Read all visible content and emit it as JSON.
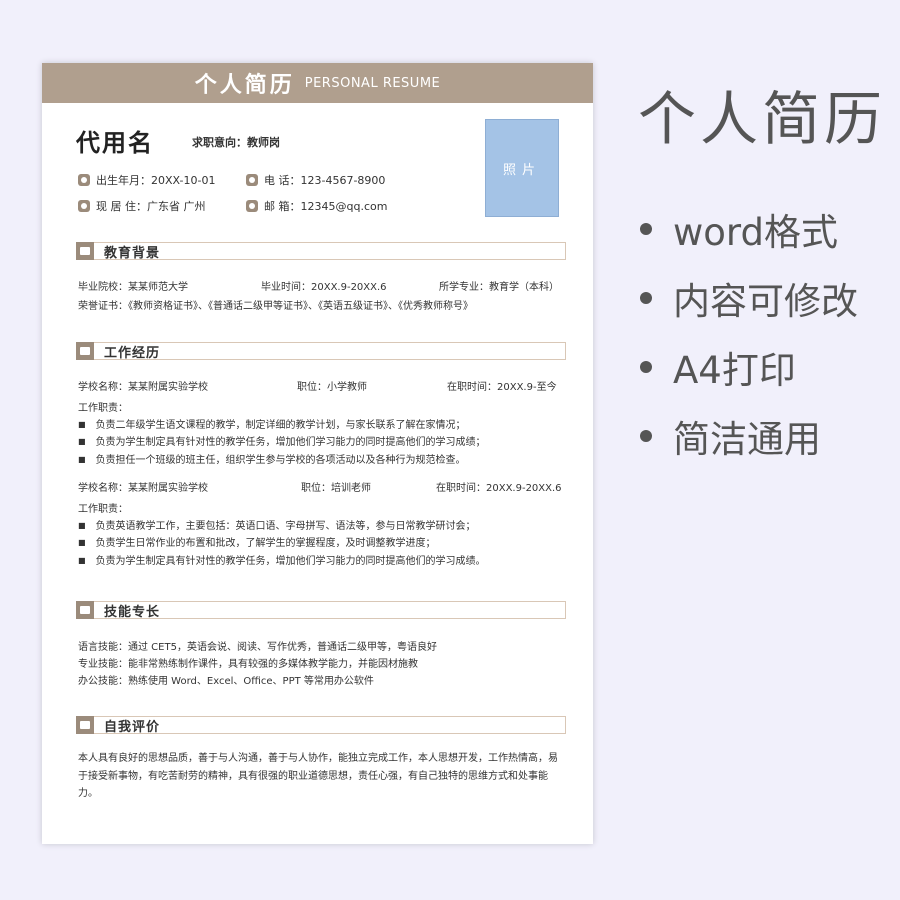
{
  "resume": {
    "title_cn": "个人简历",
    "title_en": "PERSONAL RESUME",
    "name": "代用名",
    "intent": "求职意向：教师岗",
    "photo_label": "照片",
    "info": {
      "birth": "出生年月：20XX-10-01",
      "phone": "电 话：123-4567-8900",
      "residence": "现 居 住：广东省 广州",
      "email": "邮 箱：12345@qq.com"
    },
    "education": {
      "heading": "教育背景",
      "school": "毕业院校：某某师范大学",
      "grad_time": "毕业时间：20XX.9-20XX.6",
      "major": "所学专业：教育学（本科）",
      "honors": "荣誉证书：《教师资格证书》、《普通话二级甲等证书》、《英语五级证书》、《优秀教师称号》"
    },
    "work": {
      "heading": "工作经历",
      "jobs": [
        {
          "school": "学校名称：某某附属实验学校",
          "position": "职位：小学教师",
          "time": "在职时间：20XX.9-至今",
          "duty_label": "工作职责：",
          "duties": [
            "负责二年级学生语文课程的教学，制定详细的教学计划，与家长联系了解在家情况；",
            "负责为学生制定具有针对性的教学任务，增加他们学习能力的同时提高他们的学习成绩；",
            "负责担任一个班级的班主任，组织学生参与学校的各项活动以及各种行为规范检查。"
          ]
        },
        {
          "school": "学校名称：某某附属实验学校",
          "position": "职位：培训老师",
          "time": "在职时间：20XX.9-20XX.6",
          "duty_label": "工作职责：",
          "duties": [
            "负责英语教学工作，主要包括：英语口语、字母拼写、语法等，参与日常教学研讨会；",
            "负责学生日常作业的布置和批改，了解学生的掌握程度，及时调整教学进度；",
            "负责为学生制定具有针对性的教学任务，增加他们学习能力的同时提高他们的学习成绩。"
          ]
        }
      ]
    },
    "skills": {
      "heading": "技能专长",
      "lines": [
        "语言技能：通过 CET5，英语会说、阅读、写作优秀，普通话二级甲等，粤语良好",
        "专业技能：能非常熟练制作课件，具有较强的多媒体教学能力，并能因材施教",
        "办公技能：熟练使用 Word、Excel、Office、PPT 等常用办公软件"
      ]
    },
    "self_eval": {
      "heading": "自我评价",
      "text": "本人具有良好的思想品质，善于与人沟通，善于与人协作，能独立完成工作，本人思想开发，工作热情高，易于接受新事物，有吃苦耐劳的精神，具有很强的职业道德思想，责任心强，有自己独特的思维方式和处事能力。"
    }
  },
  "side": {
    "title": "个人简历",
    "features": [
      "word格式",
      "内容可修改",
      "A4打印",
      "简洁通用"
    ]
  },
  "colors": {
    "background": "#f1f0fb",
    "accent": "#b09f8e",
    "accent_dark": "#9b8b7b",
    "photo": "#a4c3e6"
  }
}
